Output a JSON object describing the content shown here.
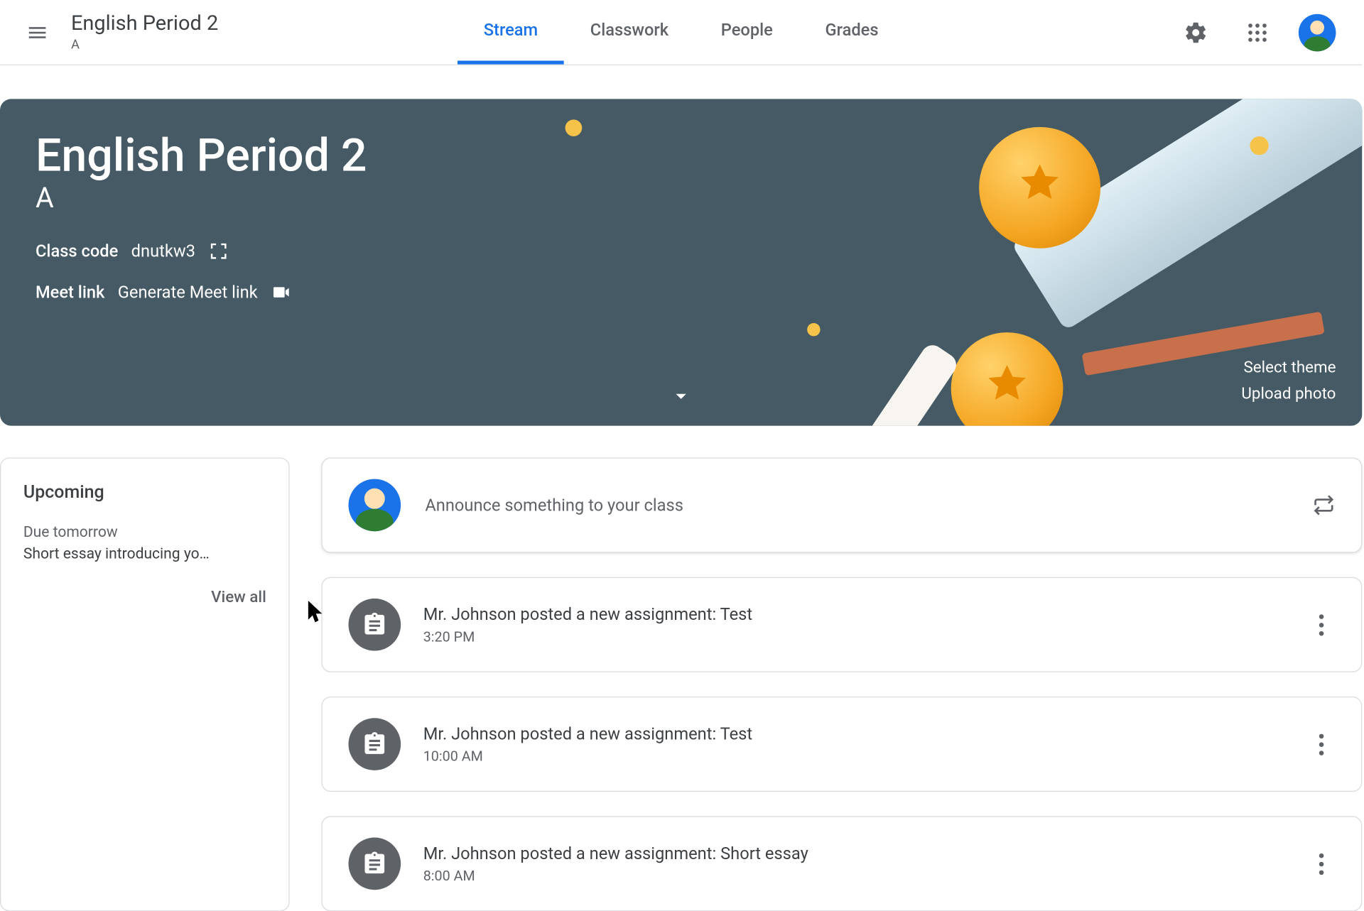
{
  "header": {
    "class_name": "English Period 2",
    "class_section": "A",
    "tabs": [
      "Stream",
      "Classwork",
      "People",
      "Grades"
    ],
    "active_tab": 0
  },
  "banner": {
    "title": "English Period 2",
    "section": "A",
    "class_code_label": "Class code",
    "class_code": "dnutkw3",
    "meet_label": "Meet link",
    "meet_action": "Generate Meet link",
    "select_theme": "Select theme",
    "upload_photo": "Upload photo"
  },
  "upcoming": {
    "heading": "Upcoming",
    "due_label": "Due tomorrow",
    "item": "Short essay introducing yo…",
    "view_all": "View all"
  },
  "announce": {
    "placeholder": "Announce something to your class"
  },
  "posts": [
    {
      "title": "Mr. Johnson posted a new assignment: Test",
      "time": "3:20 PM"
    },
    {
      "title": "Mr. Johnson posted a new assignment: Test",
      "time": "10:00 AM"
    },
    {
      "title": "Mr. Johnson posted a new assignment: Short essay",
      "time": "8:00 AM"
    }
  ]
}
